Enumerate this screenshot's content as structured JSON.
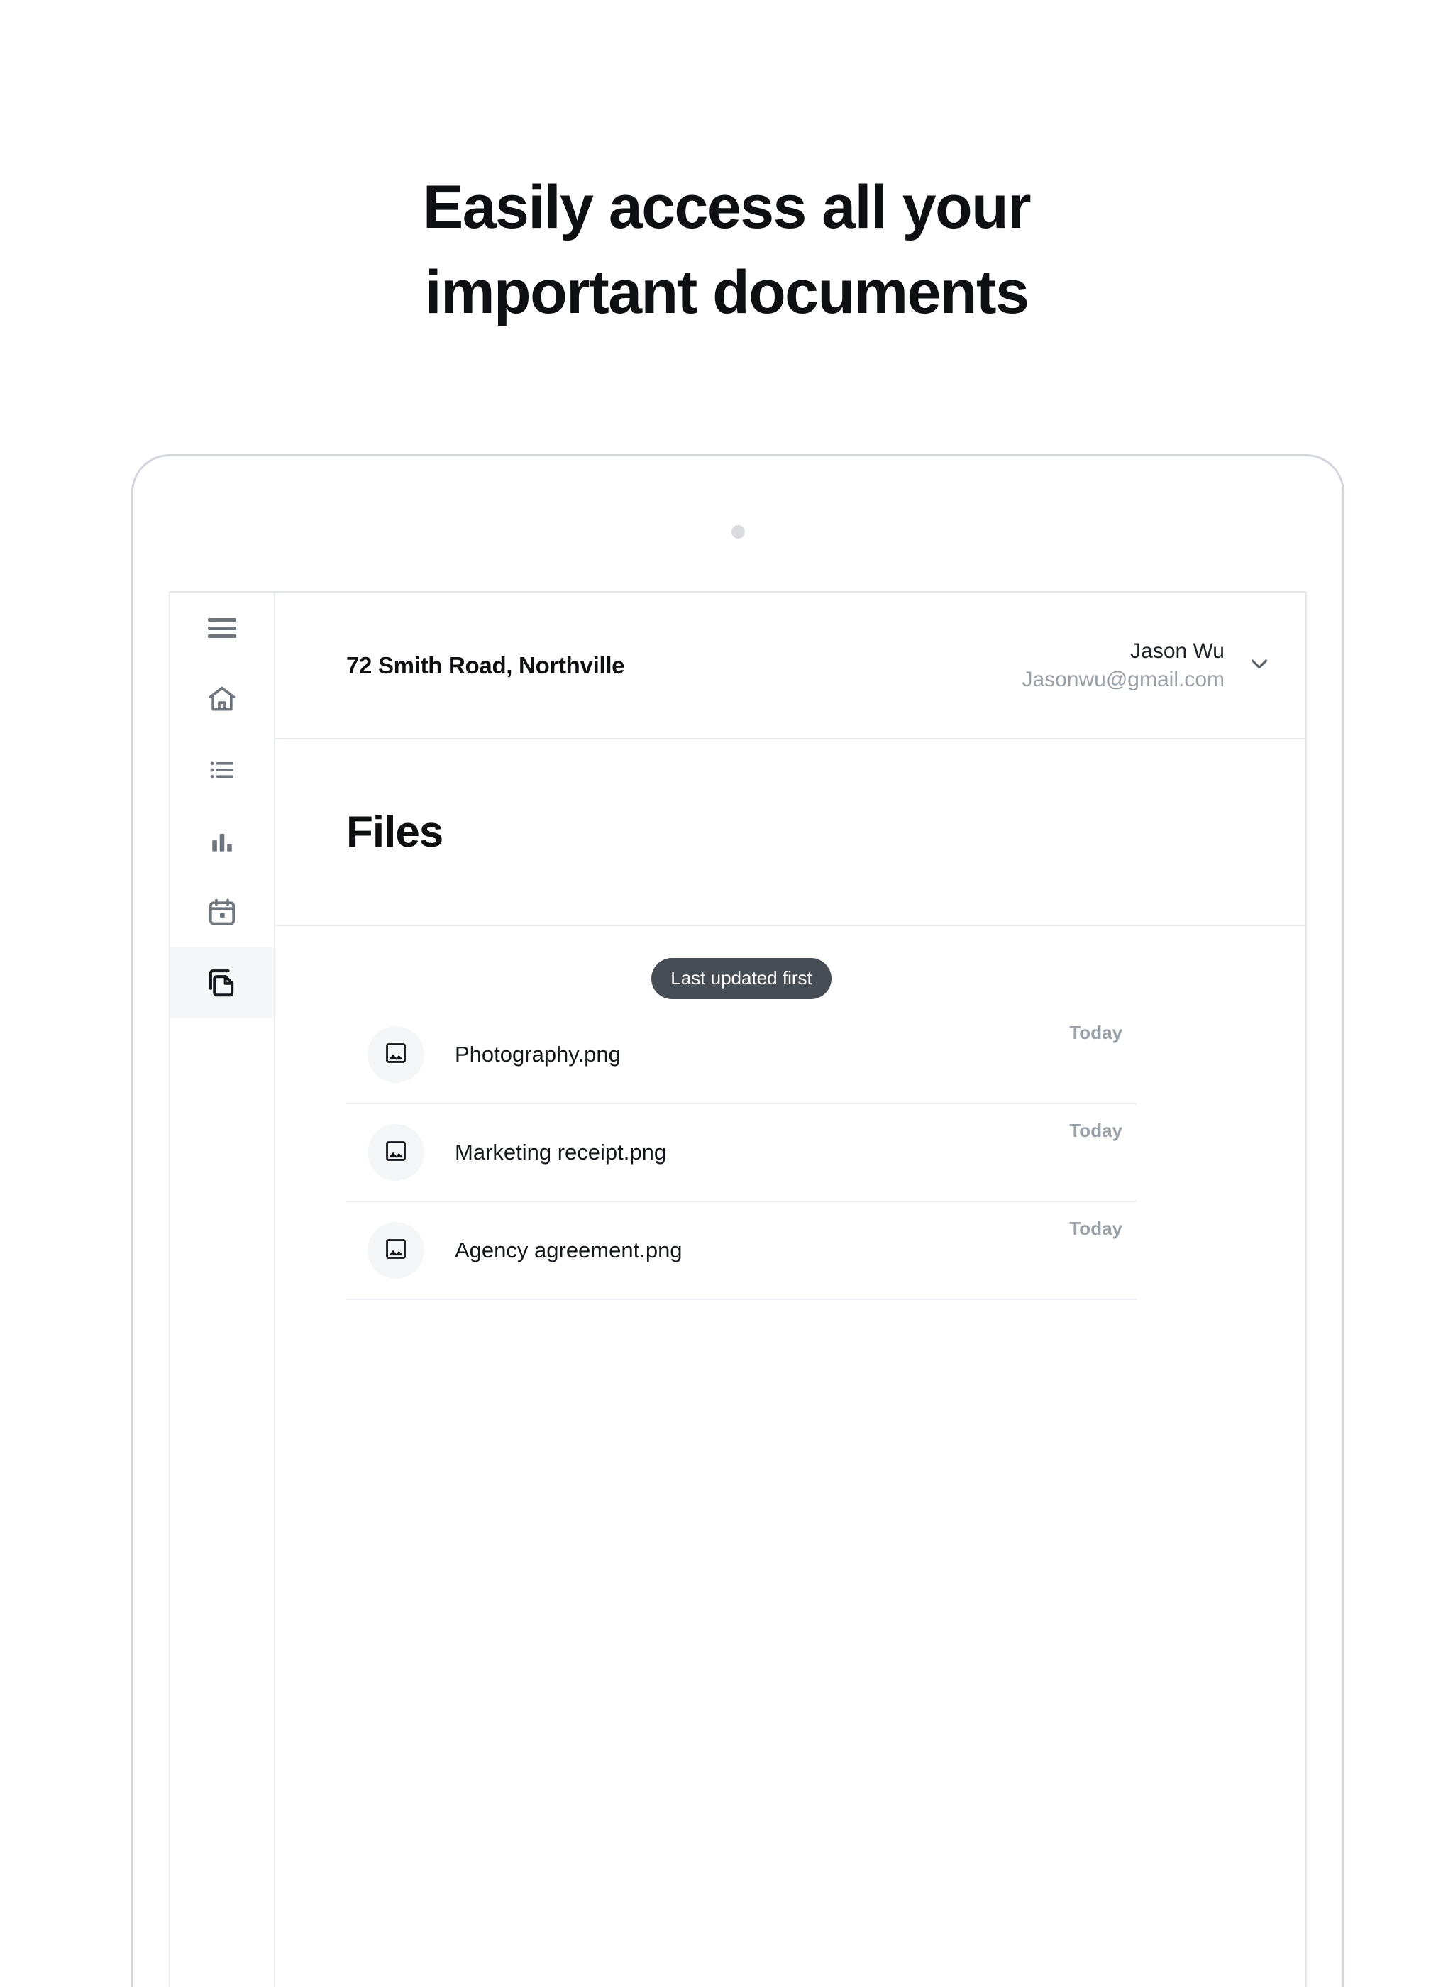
{
  "marketing": {
    "headline_line1": "Easily access all your",
    "headline_line2": "important documents"
  },
  "app": {
    "sidebar": {
      "menu_button": "menu-icon",
      "items": [
        {
          "icon": "home-icon",
          "name": "home",
          "active": false
        },
        {
          "icon": "list-icon",
          "name": "list",
          "active": false
        },
        {
          "icon": "bar-chart-icon",
          "name": "reports",
          "active": false
        },
        {
          "icon": "calendar-icon",
          "name": "calendar",
          "active": false
        },
        {
          "icon": "files-icon",
          "name": "files",
          "active": true
        }
      ]
    },
    "topbar": {
      "address": "72 Smith Road, Northville",
      "account_name": "Jason Wu",
      "account_email": "Jasonwu@gmail.com",
      "chevron": "chevron-down-icon"
    },
    "page_title": "Files",
    "sort_pill": "Last updated first",
    "files": [
      {
        "icon": "image-icon",
        "name": "Photography.png",
        "date": "Today"
      },
      {
        "icon": "image-icon",
        "name": "Marketing receipt.png",
        "date": "Today"
      },
      {
        "icon": "image-icon",
        "name": "Agency agreement.png",
        "date": "Today"
      }
    ]
  },
  "colors": {
    "background": "#ffffff",
    "text_primary": "#0d0f12",
    "text_muted": "#9aa0a8",
    "icon_gray": "#6f757d",
    "pill_bg": "#474d55",
    "divider": "#e7eaee",
    "active_nav_bg": "#f6f7f8",
    "device_border": "#d3d7dd"
  }
}
